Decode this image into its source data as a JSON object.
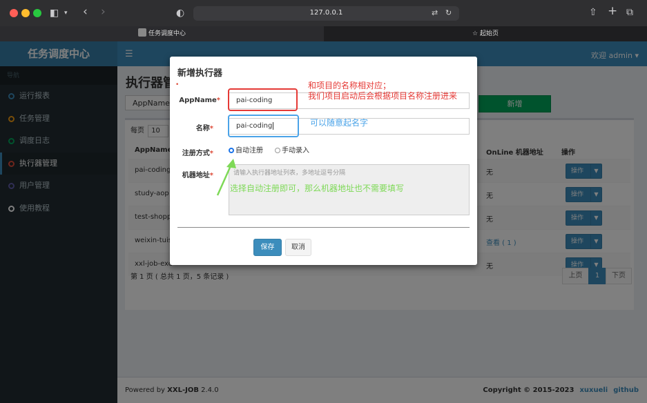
{
  "browser": {
    "url": "127.0.0.1",
    "tabs": [
      {
        "label": "任务调度中心",
        "active": true
      },
      {
        "label": "起始页",
        "active": false
      }
    ]
  },
  "app": {
    "logo": "任务调度中心",
    "welcome": "欢迎 admin ▾",
    "nav_header": "导航",
    "menu": [
      {
        "label": "运行报表",
        "color": "#3c8dbc"
      },
      {
        "label": "任务管理",
        "color": "#f39c12"
      },
      {
        "label": "调度日志",
        "color": "#00a65a"
      },
      {
        "label": "执行器管理",
        "color": "#dd4b39",
        "active": true
      },
      {
        "label": "用户管理",
        "color": "#605ca8"
      },
      {
        "label": "使用教程",
        "color": "#ffffff"
      }
    ]
  },
  "page": {
    "title": "执行器管理",
    "filter_value": "AppName",
    "new_button": "新增",
    "per_page_label": "每页",
    "per_page_value": "10",
    "columns": {
      "appname": "AppName",
      "online": "OnLine 机器地址",
      "ops": "操作"
    },
    "rows": [
      {
        "appname": "pai-coding",
        "online": "无"
      },
      {
        "appname": "study-aop",
        "online": "无"
      },
      {
        "appname": "test-shopp",
        "online": "无"
      },
      {
        "appname": "weixin-tuis",
        "online": "查看 ( 1 )"
      },
      {
        "appname": "xxl-job-exe",
        "online": "无"
      }
    ],
    "op_button": "操作",
    "page_info": "第 1 页 ( 总共 1 页，5 条记录 )",
    "pager": {
      "prev": "上页",
      "current": "1",
      "next": "下页"
    }
  },
  "footer": {
    "powered_prefix": "Powered by",
    "powered_name": "XXL-JOB",
    "version": "2.4.0",
    "copyright": "Copyright © 2015-2023",
    "author": "xuxueli",
    "github": "github"
  },
  "modal": {
    "title": "新增执行器",
    "appname_label": "AppName",
    "appname_value": "pai-coding",
    "name_label": "名称",
    "name_value": "pai-coding",
    "reg_label": "注册方式",
    "reg_auto": "自动注册",
    "reg_manual": "手动录入",
    "addr_label": "机器地址",
    "addr_placeholder": "请输入执行器地址列表，多地址逗号分隔",
    "save": "保存",
    "cancel": "取消"
  },
  "annotations": {
    "appname_note_line1": "和项目的名称相对应；",
    "appname_note_line2": "我们项目启动后会根据项目名称注册进来",
    "name_note": "可以随意起名字",
    "reg_note": "选择自动注册即可，那么机器地址也不需要填写",
    "colors": {
      "red": "#e53935",
      "blue": "#4aa3e8",
      "green": "#7ed957"
    }
  }
}
